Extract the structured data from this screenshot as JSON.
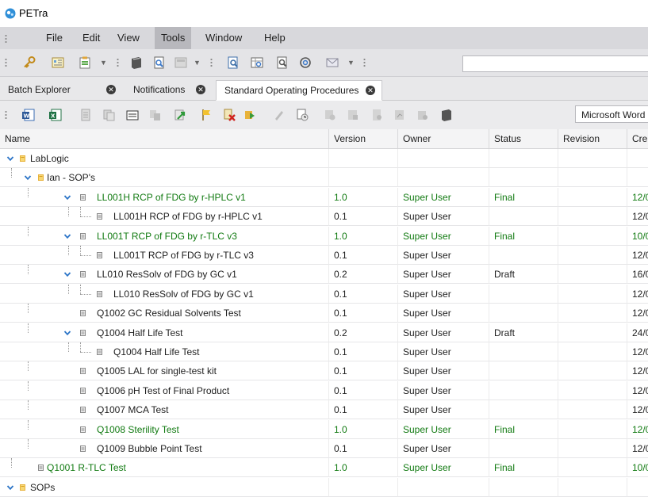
{
  "app": {
    "title": "PETra"
  },
  "menu": [
    "File",
    "Edit",
    "View",
    "Tools",
    "Window",
    "Help"
  ],
  "menu_active": "Tools",
  "tabs": [
    {
      "label": "Batch Explorer",
      "active": false
    },
    {
      "label": "Notifications",
      "active": false
    },
    {
      "label": "Standard Operating Procedures",
      "active": true
    }
  ],
  "toolbar1_icons": [
    "key-icon",
    "document-icon",
    "clipboard-icon",
    "book-icon",
    "search-page-icon",
    "panel-icon",
    "document-search-icon",
    "table-search-icon",
    "magnifier-page-icon",
    "refresh-search-icon",
    "mail-icon"
  ],
  "toolbar2_icons": [
    "word-icon",
    "excel-icon",
    "doc-gray-icon",
    "copy-gray-icon",
    "folder-open-icon",
    "merge-gray-icon",
    "green-arrow-icon",
    "flag-icon",
    "delete-icon",
    "next-icon",
    "pen-gray-icon",
    "pending-icon",
    "reload-gray-icon",
    "preview-gray-icon",
    "doc2-gray-icon",
    "chart-gray-icon",
    "stack-gray-icon",
    "book2-icon"
  ],
  "word_combo": "Microsoft Word",
  "columns": {
    "name": "Name",
    "version": "Version",
    "owner": "Owner",
    "status": "Status",
    "revision": "Revision",
    "created": "Cre"
  },
  "rows": [
    {
      "name": "LabLogic",
      "version": "",
      "owner": "",
      "status": "",
      "revision": "",
      "created": "",
      "level": 0,
      "expanded": true,
      "folder": true,
      "color": "dark"
    },
    {
      "name": "Ian - SOP's",
      "version": "",
      "owner": "",
      "status": "",
      "revision": "",
      "created": "",
      "level": 1,
      "expanded": true,
      "folder": true,
      "color": "dark"
    },
    {
      "name": "LL001H RCP of FDG by r-HPLC v1",
      "version": "1.0",
      "owner": "Super User",
      "status": "Final",
      "revision": "",
      "created": "12/0",
      "level": 2,
      "expanded": true,
      "color": "green"
    },
    {
      "name": "LL001H RCP of FDG by r-HPLC v1",
      "version": "0.1",
      "owner": "Super User",
      "status": "",
      "revision": "",
      "created": "12/0",
      "level": 3,
      "color": "dark"
    },
    {
      "name": "LL001T RCP of FDG by r-TLC v3",
      "version": "1.0",
      "owner": "Super User",
      "status": "Final",
      "revision": "",
      "created": "10/0",
      "level": 2,
      "expanded": true,
      "color": "green"
    },
    {
      "name": "LL001T RCP of FDG by r-TLC v3",
      "version": "0.1",
      "owner": "Super User",
      "status": "",
      "revision": "",
      "created": "12/0",
      "level": 3,
      "color": "dark"
    },
    {
      "name": "LL010 ResSolv of FDG by GC v1",
      "version": "0.2",
      "owner": "Super User",
      "status": "Draft",
      "revision": "",
      "created": "16/0",
      "level": 2,
      "expanded": true,
      "color": "dark"
    },
    {
      "name": "LL010 ResSolv of FDG by GC v1",
      "version": "0.1",
      "owner": "Super User",
      "status": "",
      "revision": "",
      "created": "12/0",
      "level": 3,
      "color": "dark"
    },
    {
      "name": "Q1002 GC Residual Solvents Test",
      "version": "0.1",
      "owner": "Super User",
      "status": "",
      "revision": "",
      "created": "12/0",
      "level": 2,
      "color": "dark"
    },
    {
      "name": "Q1004 Half Life Test",
      "version": "0.2",
      "owner": "Super User",
      "status": "Draft",
      "revision": "",
      "created": "24/0",
      "level": 2,
      "expanded": true,
      "color": "dark"
    },
    {
      "name": "Q1004 Half Life Test",
      "version": "0.1",
      "owner": "Super User",
      "status": "",
      "revision": "",
      "created": "12/0",
      "level": 3,
      "color": "dark"
    },
    {
      "name": "Q1005 LAL for single-test kit",
      "version": "0.1",
      "owner": "Super User",
      "status": "",
      "revision": "",
      "created": "12/0",
      "level": 2,
      "color": "dark"
    },
    {
      "name": "Q1006 pH Test of Final Product",
      "version": "0.1",
      "owner": "Super User",
      "status": "",
      "revision": "",
      "created": "12/0",
      "level": 2,
      "color": "dark"
    },
    {
      "name": "Q1007 MCA Test",
      "version": "0.1",
      "owner": "Super User",
      "status": "",
      "revision": "",
      "created": "12/0",
      "level": 2,
      "color": "dark"
    },
    {
      "name": "Q1008 Sterility Test",
      "version": "1.0",
      "owner": "Super User",
      "status": "Final",
      "revision": "",
      "created": "12/0",
      "level": 2,
      "color": "green"
    },
    {
      "name": "Q1009 Bubble Point Test",
      "version": "0.1",
      "owner": "Super User",
      "status": "",
      "revision": "",
      "created": "12/0",
      "level": 2,
      "color": "dark"
    },
    {
      "name": "Q1001 R-TLC Test",
      "version": "1.0",
      "owner": "Super User",
      "status": "Final",
      "revision": "",
      "created": "10/0",
      "level": 1,
      "color": "green"
    },
    {
      "name": "SOPs",
      "version": "",
      "owner": "",
      "status": "",
      "revision": "",
      "created": "",
      "level": 0,
      "expanded": true,
      "folder": true,
      "color": "dark"
    }
  ],
  "colors": {
    "accent_green": "#117a11",
    "folder_yellow": "#e8b23a",
    "expander_blue": "#2b74c7"
  }
}
